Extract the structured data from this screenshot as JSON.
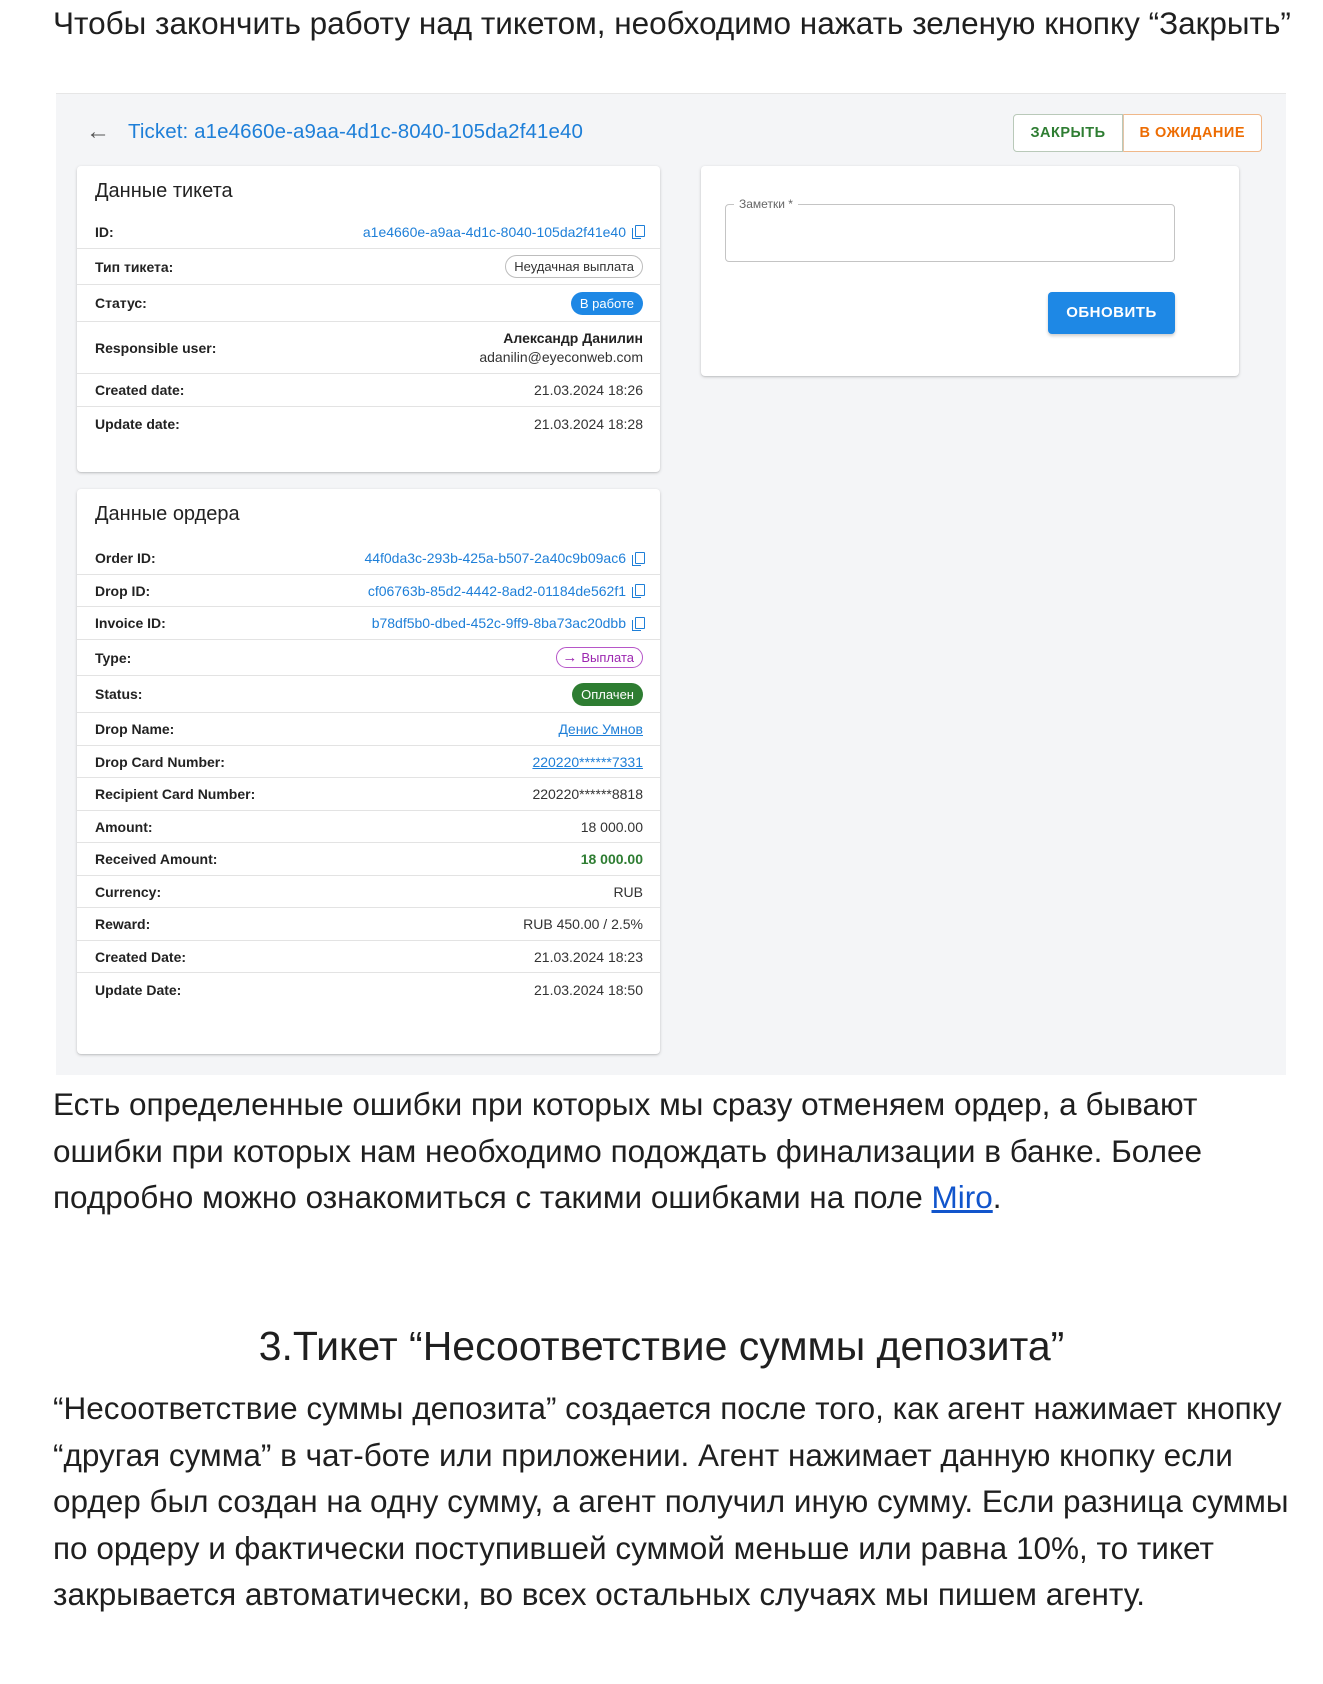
{
  "intro_text": "Чтобы закончить работу над тикетом, необходимо нажать зеленую кнопку “Закрыть”",
  "screenshot": {
    "ticket_title": "Ticket: a1e4660e-a9aa-4d1c-8040-105da2f41e40",
    "buttons": {
      "close": "ЗАКРЫТЬ",
      "wait": "В ОЖИДАНИЕ",
      "update": "ОБНОВИТЬ"
    },
    "notes_label": "Заметки *",
    "ticket_card": {
      "title": "Данные тикета",
      "rows": [
        {
          "label": "ID:",
          "value": "a1e4660e-a9aa-4d1c-8040-105da2f41e40"
        },
        {
          "label": "Тип тикета:",
          "value": "Неудачная выплата"
        },
        {
          "label": "Статус:",
          "value": "В работе"
        },
        {
          "label": "Responsible user:",
          "name": "Александр Данилин",
          "email": "adanilin@eyeconweb.com"
        },
        {
          "label": "Created date:",
          "value": "21.03.2024 18:26"
        },
        {
          "label": "Update date:",
          "value": "21.03.2024 18:28"
        }
      ]
    },
    "order_card": {
      "title": "Данные ордера",
      "rows": [
        {
          "label": "Order ID:",
          "value": "44f0da3c-293b-425a-b507-2a40c9b09ac6"
        },
        {
          "label": "Drop ID:",
          "value": "cf06763b-85d2-4442-8ad2-01184de562f1"
        },
        {
          "label": "Invoice ID:",
          "value": "b78df5b0-dbed-452c-9ff9-8ba73ac20dbb"
        },
        {
          "label": "Type:",
          "value": "Выплата"
        },
        {
          "label": "Status:",
          "value": "Оплачен"
        },
        {
          "label": "Drop Name:",
          "value": "Денис Умнов"
        },
        {
          "label": "Drop Card Number:",
          "value": "220220******7331"
        },
        {
          "label": "Recipient Card Number:",
          "value": "220220******8818"
        },
        {
          "label": "Amount:",
          "value": "18 000.00"
        },
        {
          "label": "Received Amount:",
          "value": "18 000.00"
        },
        {
          "label": "Currency:",
          "value": "RUB"
        },
        {
          "label": "Reward:",
          "value": "RUB 450.00 / 2.5%"
        },
        {
          "label": "Created Date:",
          "value": "21.03.2024 18:23"
        },
        {
          "label": "Update Date:",
          "value": "21.03.2024 18:50"
        }
      ]
    }
  },
  "para2_text": "Есть определенные ошибки при которых мы сразу отменяем ордер, а бывают ошибки при которых нам необходимо подождать финализации в банке. Более подробно можно ознакомиться с такими ошибками на поле ",
  "para2_link": "Miro",
  "para2_end": ".",
  "heading": "3.Тикет “Несоответствие суммы депозита”",
  "para3_text": "“Несоответствие суммы депозита” создается после того, как агент нажимает кнопку “другая сумма” в чат-боте или приложении. Агент нажимает данную кнопку если ордер был создан на одну сумму, а агент получил иную сумму. Если разница суммы по ордеру и фактически поступившей суммой меньше или равна 10%, то тикет закрывается автоматически, во всех остальных случаях мы пишем агенту."
}
